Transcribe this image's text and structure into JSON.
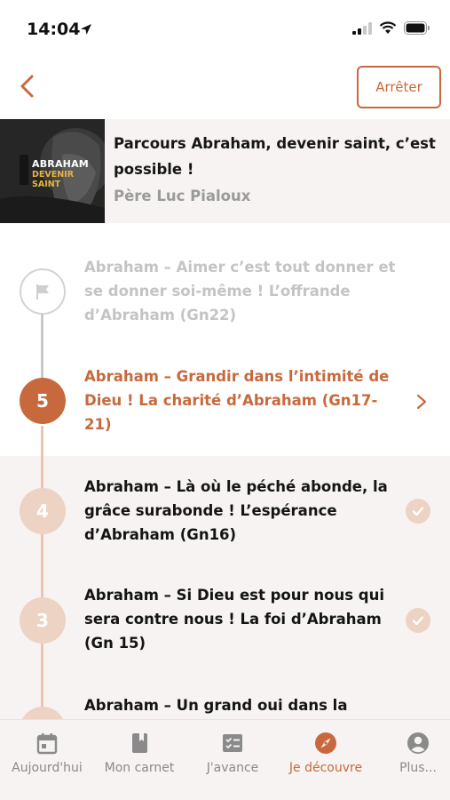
{
  "status_bar": {
    "time": "14:04"
  },
  "nav": {
    "stop_label": "Arrêter"
  },
  "course": {
    "thumbnail_line1": "ABRAHAM",
    "thumbnail_line2": "DEVENIR SAINT",
    "title": "Parcours Abraham, devenir saint, c’est possible !",
    "author": "Père Luc Pialoux"
  },
  "steps": [
    {
      "state": "locked",
      "badge": "",
      "title": "Abraham – Aimer c’est tout donner et se donner soi-même ! L’offrande d’Abraham (Gn22)"
    },
    {
      "state": "current",
      "badge": "5",
      "title": "Abraham – Grandir dans l’intimité de Dieu ! La charité d’Abraham (Gn17-21)"
    },
    {
      "state": "done",
      "badge": "4",
      "title": "Abraham – Là où le péché abonde, la grâce surabonde ! L’espérance d’Abraham (Gn16)"
    },
    {
      "state": "done",
      "badge": "3",
      "title": "Abraham – Si Dieu est pour nous qui sera contre nous ! La foi d’Abraham (Gn 15)"
    },
    {
      "state": "done",
      "badge": "",
      "title": "Abraham – Un grand oui dans la"
    }
  ],
  "tabs": [
    {
      "label": "Aujourd'hui",
      "icon": "calendar-icon"
    },
    {
      "label": "Mon carnet",
      "icon": "notebook-icon"
    },
    {
      "label": "J'avance",
      "icon": "checklist-icon"
    },
    {
      "label": "Je découvre",
      "icon": "compass-icon",
      "active": true
    },
    {
      "label": "Plus...",
      "icon": "account-icon"
    }
  ],
  "colors": {
    "accent": "#c8693d",
    "accent_light": "#ecd3c3",
    "panel_bg": "#f6f3f2"
  }
}
